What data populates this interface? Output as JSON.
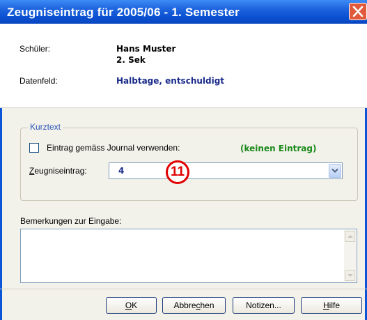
{
  "window": {
    "title": "Zeugniseintrag für 2005/06 - 1. Semester",
    "accent_color": "#0a4fd0",
    "close_icon": "close-icon"
  },
  "info": {
    "schueler_label": "Schüler:",
    "schueler_name": "Hans Muster",
    "schueler_class": "2. Sek",
    "datenfeld_label": "Datenfeld:",
    "datenfeld_value": "Halbtage, entschuldigt"
  },
  "kurztext": {
    "legend": "Kurztext",
    "checkbox_label": "Eintrag gemäss Journal verwenden:",
    "checkbox_checked": false,
    "journal_status": "(keinen Eintrag)",
    "zeugnis_label": "Zeugniseintrag:",
    "zeugnis_value": "4",
    "dropdown_icon": "chevron-down-icon"
  },
  "annotation": {
    "badge_text": "11",
    "badge_color": "#e00000"
  },
  "remarks": {
    "label": "Bemerkungen zur Eingabe:",
    "value": ""
  },
  "buttons": {
    "ok": "OK",
    "abbrechen": "Abbrechen",
    "notizen": "Notizen...",
    "hilfe": "Hilfe"
  }
}
